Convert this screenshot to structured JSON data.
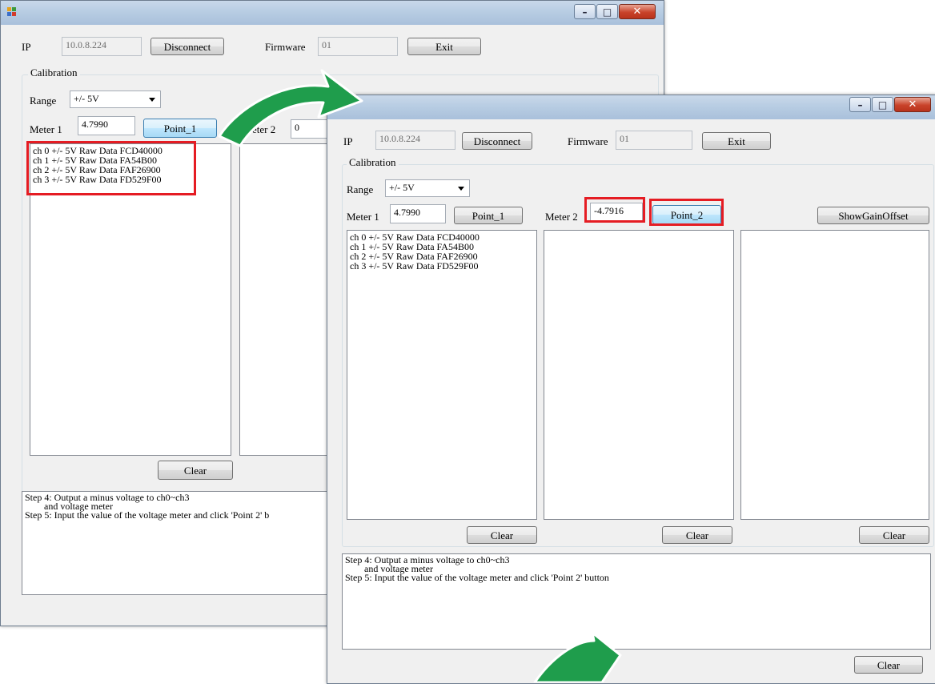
{
  "connection": {
    "ip_label": "IP",
    "ip_value": "10.0.8.224",
    "disconnect_label": "Disconnect",
    "firmware_label": "Firmware",
    "firmware_value": "01",
    "exit_label": "Exit"
  },
  "calibration": {
    "group_title": "Calibration",
    "range_label": "Range",
    "range_value": "+/- 5V",
    "meter1_label": "Meter 1",
    "meter2_label": "Meter 2",
    "point1_label": "Point_1",
    "point2_label": "Point_2",
    "show_gain_offset_label": "ShowGainOffset",
    "clear_label": "Clear"
  },
  "back_window": {
    "meter1_value": "4.7990",
    "meter2_value": "0",
    "meter2_label_partial": "eter 2",
    "raw_data": [
      "ch 0 +/- 5V Raw Data FCD40000",
      "ch 1 +/- 5V Raw Data FA54B00",
      "ch 2 +/- 5V Raw Data FAF26900",
      "ch 3 +/- 5V Raw Data FD529F00"
    ],
    "status_lines": [
      "Step 4: Output a minus voltage to ch0~ch3",
      "        and voltage meter",
      "Step 5: Input the value of the voltage meter and click 'Point 2' b"
    ]
  },
  "front_window": {
    "meter1_value": "4.7990",
    "meter2_value": "-4.7916",
    "raw_data": [
      "ch 0 +/- 5V Raw Data FCD40000",
      "ch 1 +/- 5V Raw Data FA54B00",
      "ch 2 +/- 5V Raw Data FAF26900",
      "ch 3 +/- 5V Raw Data FD529F00"
    ],
    "status_lines": [
      "Step 4: Output a minus voltage to ch0~ch3",
      "        and voltage meter",
      "Step 5: Input the value of the voltage meter and click 'Point 2' button"
    ],
    "status_clear_label": "Clear"
  },
  "colors": {
    "highlight": "#e51c23",
    "arrow_green": "#1f9d4c"
  },
  "icons": [
    "app-icon",
    "minimize-icon",
    "maximize-icon",
    "close-icon",
    "dropdown-arrow-icon",
    "transition-arrow-icon"
  ]
}
